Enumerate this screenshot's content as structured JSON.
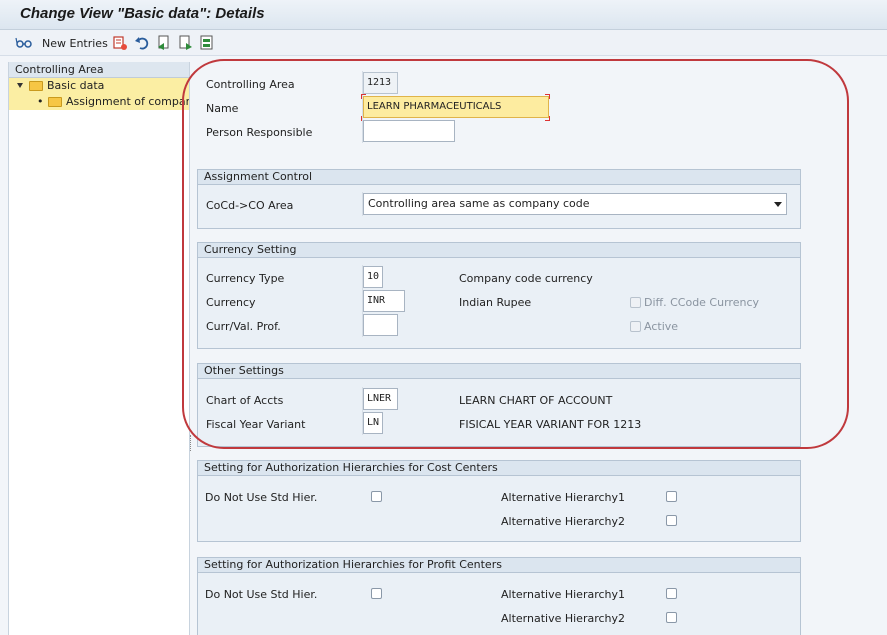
{
  "window": {
    "title": "Change View \"Basic data\": Details"
  },
  "toolbar": {
    "new_entries_label": "New Entries"
  },
  "nav": {
    "header": "Controlling Area",
    "items": [
      {
        "label": "Basic data"
      },
      {
        "label": "Assignment of company code(s)"
      }
    ]
  },
  "header_fields": {
    "controlling_area": {
      "label": "Controlling Area",
      "value": "1213"
    },
    "name": {
      "label": "Name",
      "value": "LEARN PHARMACEUTICALS"
    },
    "person_responsible": {
      "label": "Person Responsible",
      "value": ""
    }
  },
  "assignment_control": {
    "title": "Assignment Control",
    "coco_label": "CoCd->CO Area",
    "coco_value": "Controlling area same as company code"
  },
  "currency_setting": {
    "title": "Currency Setting",
    "currency_type_label": "Currency Type",
    "currency_type_value": "10",
    "currency_type_desc": "Company code currency",
    "currency_label": "Currency",
    "currency_value": "INR",
    "currency_desc": "Indian Rupee",
    "diff_ccode_label": "Diff. CCode Currency",
    "curr_val_prof_label": "Curr/Val. Prof.",
    "curr_val_prof_value": "",
    "active_label": "Active"
  },
  "other_settings": {
    "title": "Other Settings",
    "chart_label": "Chart of Accts",
    "chart_value": "LNER",
    "chart_desc": "LEARN CHART OF ACCOUNT",
    "fyv_label": "Fiscal Year Variant",
    "fyv_value": "LN",
    "fyv_desc": "FISICAL YEAR VARIANT FOR 1213"
  },
  "auth_cost_centers": {
    "title": "Setting for Authorization Hierarchies for Cost Centers",
    "no_std_label": "Do Not Use Std Hier.",
    "alt1_label": "Alternative Hierarchy1",
    "alt2_label": "Alternative Hierarchy2"
  },
  "auth_profit_centers": {
    "title": "Setting for Authorization Hierarchies for Profit Centers",
    "no_std_label": "Do Not Use Std Hier.",
    "alt1_label": "Alternative Hierarchy1",
    "alt2_label": "Alternative Hierarchy2"
  },
  "colors": {
    "highlight": "#fdeca0",
    "annotation_circle": "#c0393d",
    "group_bg": "#eaf0f6"
  }
}
